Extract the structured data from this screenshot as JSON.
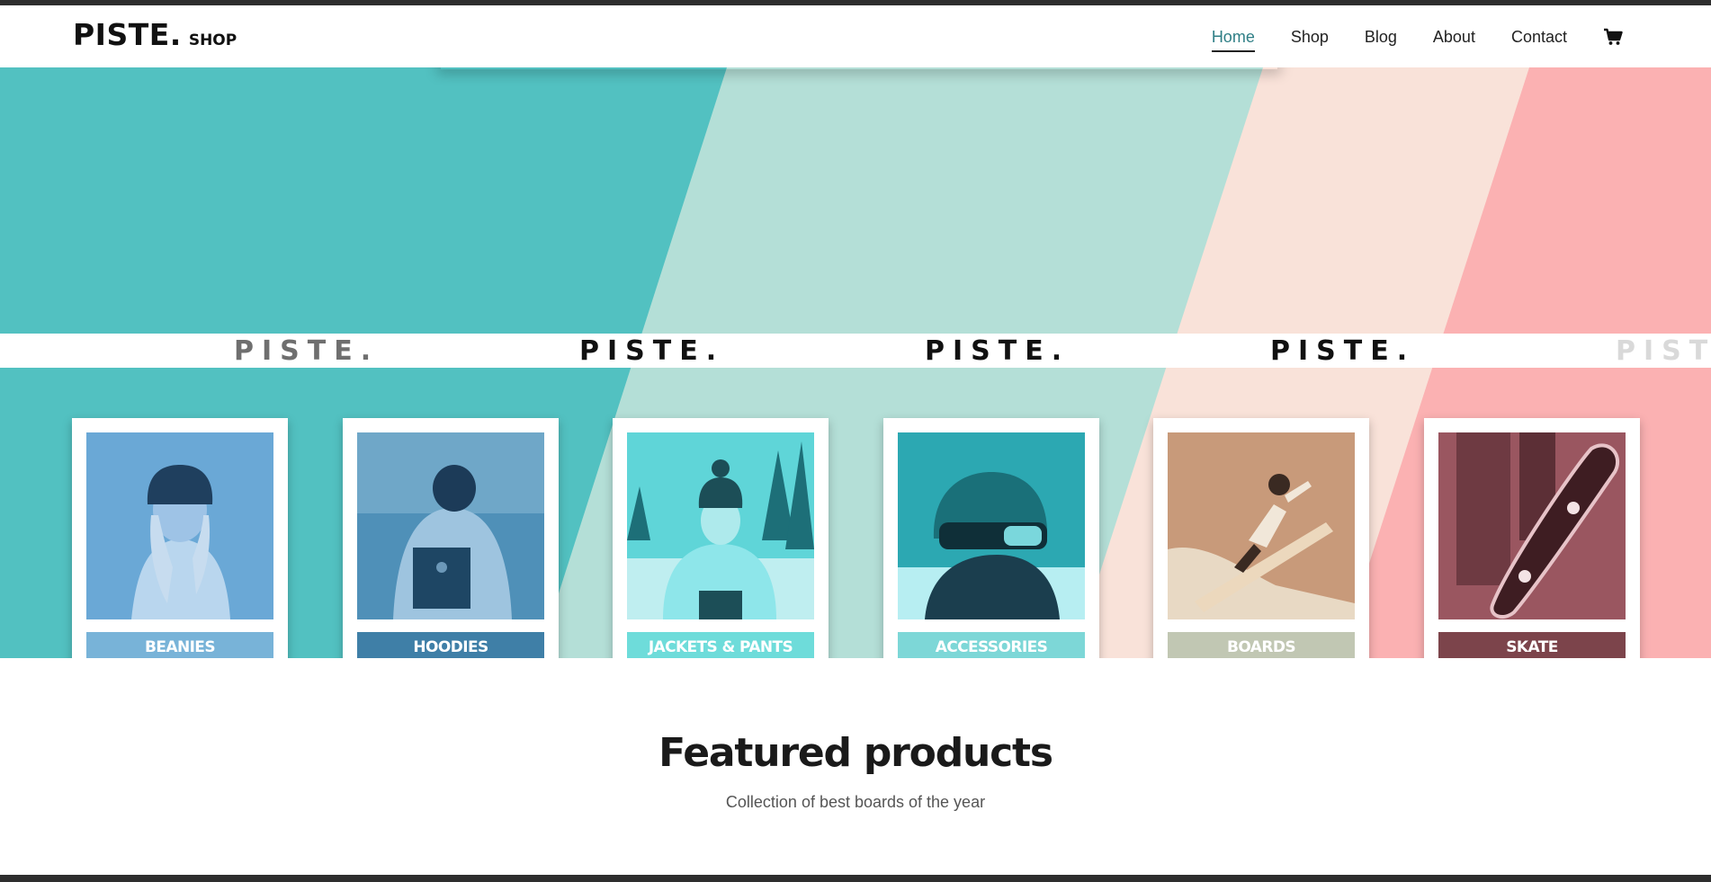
{
  "header": {
    "logo_main": "PISTE.",
    "logo_sub": "SHOP",
    "nav": [
      {
        "label": "Home",
        "active": true
      },
      {
        "label": "Shop"
      },
      {
        "label": "Blog"
      },
      {
        "label": "About"
      },
      {
        "label": "Contact"
      }
    ],
    "cart_icon": "cart-icon"
  },
  "hero": {
    "stripe_colors": [
      "#52c1c1",
      "#b4dfd7",
      "#f9e2d9",
      "#fbb1b2"
    ],
    "ticker_word": "PISTE."
  },
  "categories": [
    {
      "label": "BEANIES",
      "color": "#78b3d8",
      "tint": "#6aa8d6"
    },
    {
      "label": "HOODIES",
      "color": "#3f7fa7",
      "tint": "#4f90b8"
    },
    {
      "label": "JACKETS & PANTS",
      "color": "#6edcda",
      "tint": "#5fd5d8"
    },
    {
      "label": "ACCESSORIES",
      "color": "#7dd7d7",
      "tint": "#2ca8b2"
    },
    {
      "label": "BOARDS",
      "color": "#c1c7b3",
      "tint": "#c89a7a"
    },
    {
      "label": "SKATE",
      "color": "#7c444b",
      "tint": "#9a5660"
    }
  ],
  "featured": {
    "title": "Featured products",
    "subtitle": "Collection of best boards of the year"
  }
}
